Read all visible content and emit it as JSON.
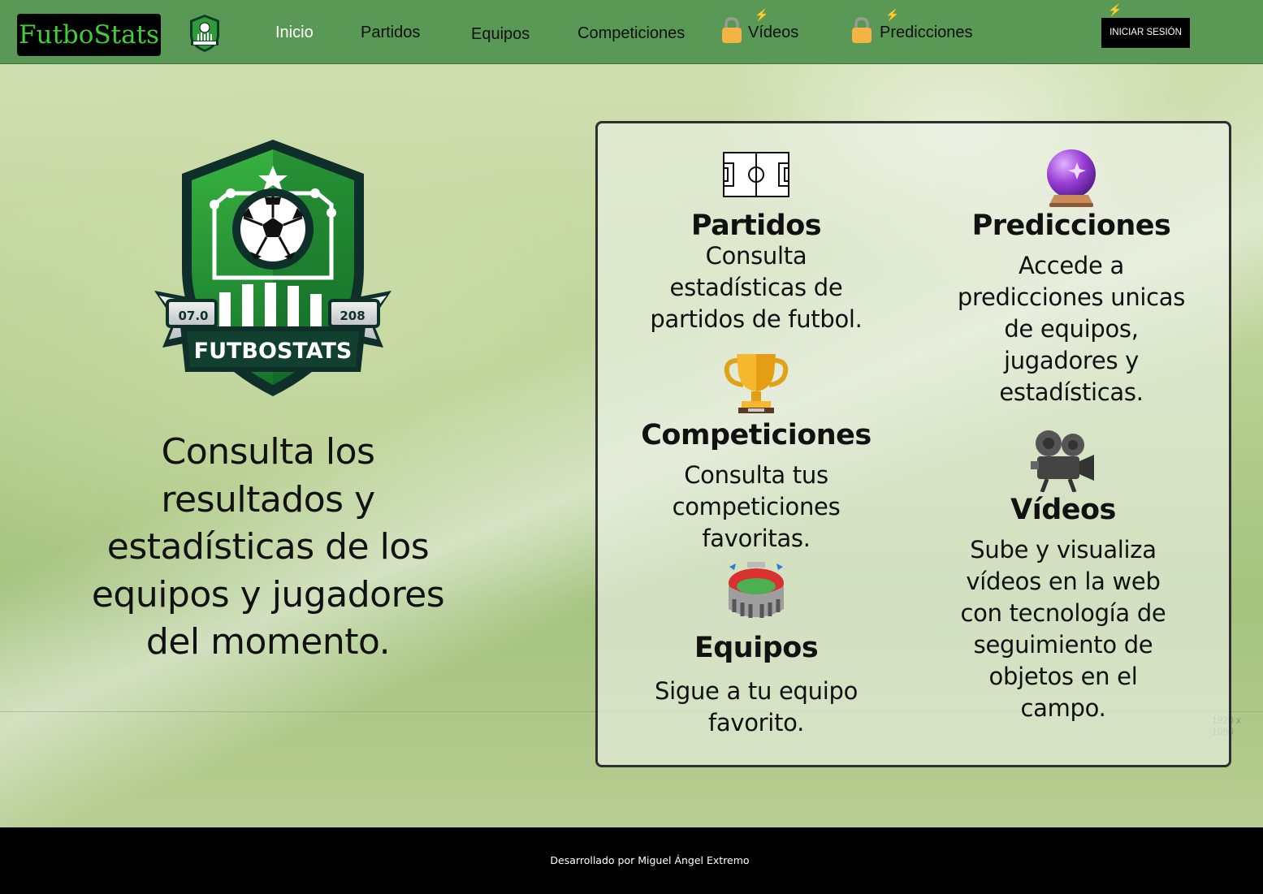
{
  "navbar": {
    "brand": "FutboStats",
    "items": [
      {
        "label": "Inicio",
        "active": true
      },
      {
        "label": "Partidos"
      },
      {
        "label": "Equipos"
      },
      {
        "label": "Competiciones"
      },
      {
        "label": "Vídeos",
        "locked": true
      },
      {
        "label": "Predicciones",
        "locked": true
      }
    ],
    "login_label": "INICIAR SESIÓN"
  },
  "crest": {
    "name": "FUTBOSTATS",
    "year_left": "07.0",
    "year_right": "208"
  },
  "hero": {
    "text": "Consulta los resultados y estadísticas de los equipos y jugadores del momento."
  },
  "features": {
    "partidos": {
      "icon": "soccer-field-icon",
      "title": "Partidos",
      "desc": "Consulta estadísticas de partidos de futbol."
    },
    "competiciones": {
      "icon": "trophy-icon",
      "title": "Competiciones",
      "desc": "Consulta tus competiciones favoritas."
    },
    "equipos": {
      "icon": "stadium-icon",
      "title": "Equipos",
      "desc": "Sigue a tu equipo favorito."
    },
    "predicciones": {
      "icon": "crystal-ball-icon",
      "title": "Predicciones",
      "desc": "Accede a predicciones unicas de equipos, jugadores y estadísticas."
    },
    "videos": {
      "icon": "movie-camera-icon",
      "title": "Vídeos",
      "desc": "Sube y visualiza vídeos en la web con tecnología de seguimiento de objetos en el campo."
    }
  },
  "overlay": {
    "resolution_label": "1920 x 1080"
  },
  "footer": {
    "credit": "Desarrollado por Miguel Ángel Extremo"
  },
  "colors": {
    "navbar": "#5a9856",
    "brand_text": "#3fcf36",
    "footer": "#000000",
    "lock": "#f5b342"
  }
}
